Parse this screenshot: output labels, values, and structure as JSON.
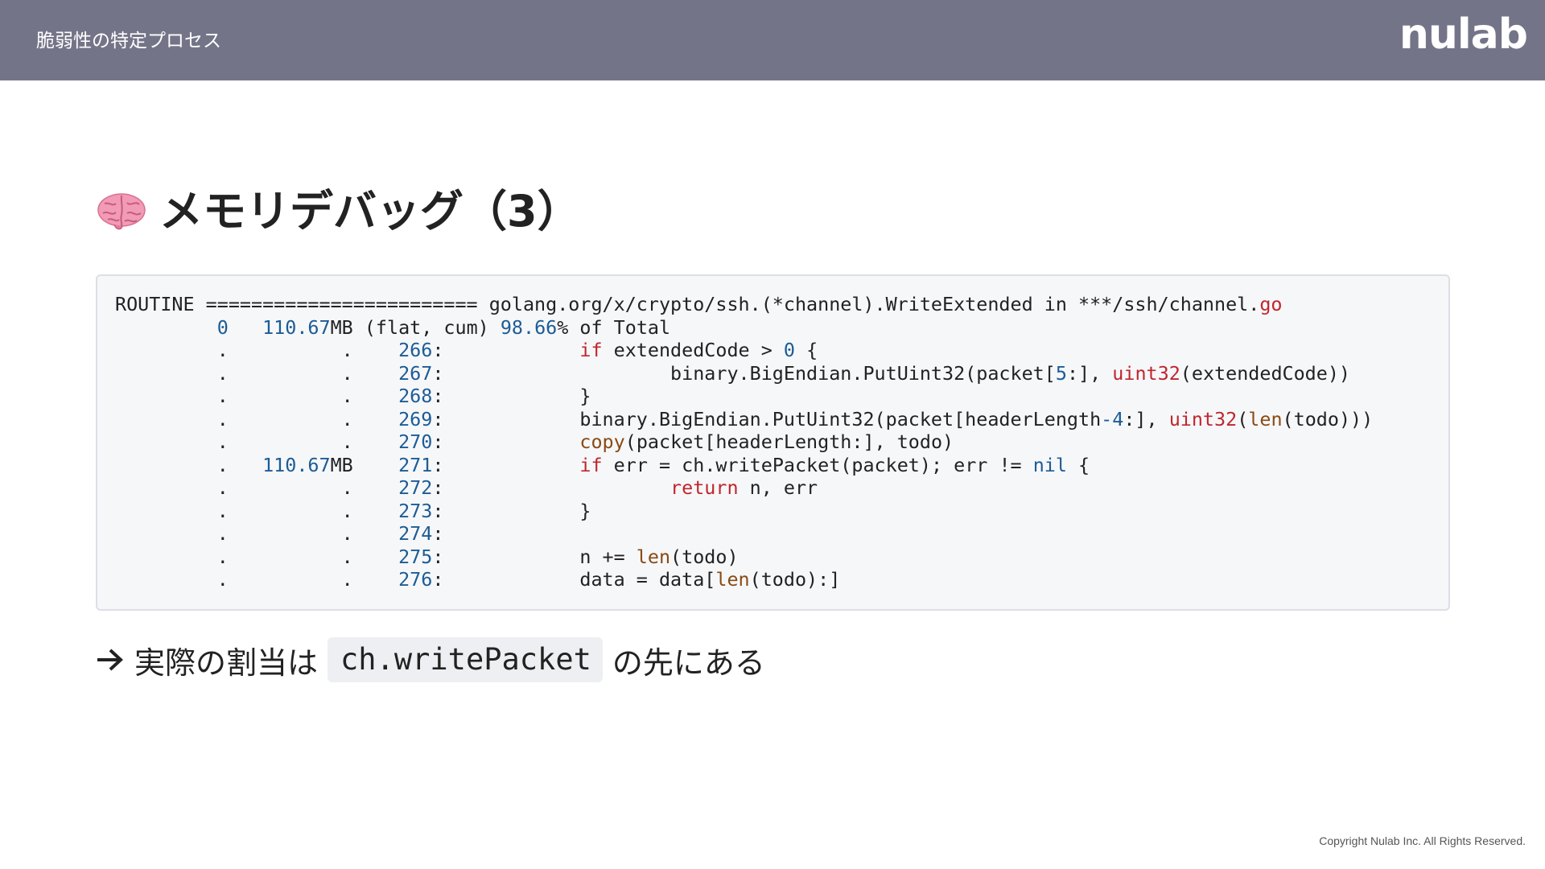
{
  "header": {
    "title": "脆弱性の特定プロセス",
    "logo_text": "nulab"
  },
  "slide": {
    "heading": "メモリデバッグ（3）",
    "heading_icon": "brain-emoji"
  },
  "code": {
    "lines": [
      [
        {
          "t": "ROUTINE ======================== golang.org/x/crypto/ssh.(*channel).WriteExtended in ***/ssh/channel."
        },
        {
          "t": "go",
          "c": "kw"
        }
      ],
      [
        {
          "t": "         "
        },
        {
          "t": "0",
          "c": "num"
        },
        {
          "t": "   "
        },
        {
          "t": "110.67",
          "c": "num"
        },
        {
          "t": "MB (flat, cum) "
        },
        {
          "t": "98.66",
          "c": "num"
        },
        {
          "t": "% of Total"
        }
      ],
      [
        {
          "t": "         .          .    "
        },
        {
          "t": "266",
          "c": "num"
        },
        {
          "t": ":            "
        },
        {
          "t": "if",
          "c": "kw"
        },
        {
          "t": " extendedCode > "
        },
        {
          "t": "0",
          "c": "num"
        },
        {
          "t": " {"
        }
      ],
      [
        {
          "t": "         .          .    "
        },
        {
          "t": "267",
          "c": "num"
        },
        {
          "t": ":                    binary.BigEndian.PutUint32(packet["
        },
        {
          "t": "5",
          "c": "num"
        },
        {
          "t": ":], "
        },
        {
          "t": "uint32",
          "c": "kw"
        },
        {
          "t": "(extendedCode))"
        }
      ],
      [
        {
          "t": "         .          .    "
        },
        {
          "t": "268",
          "c": "num"
        },
        {
          "t": ":            }"
        }
      ],
      [
        {
          "t": "         .          .    "
        },
        {
          "t": "269",
          "c": "num"
        },
        {
          "t": ":            binary.BigEndian.PutUint32(packet[headerLength"
        },
        {
          "t": "-4",
          "c": "num"
        },
        {
          "t": ":], "
        },
        {
          "t": "uint32",
          "c": "kw"
        },
        {
          "t": "("
        },
        {
          "t": "len",
          "c": "fn"
        },
        {
          "t": "(todo)))"
        }
      ],
      [
        {
          "t": "         .          .    "
        },
        {
          "t": "270",
          "c": "num"
        },
        {
          "t": ":            "
        },
        {
          "t": "copy",
          "c": "fn"
        },
        {
          "t": "(packet[headerLength:], todo)"
        }
      ],
      [
        {
          "t": "         .   "
        },
        {
          "t": "110.67",
          "c": "num"
        },
        {
          "t": "MB    "
        },
        {
          "t": "271",
          "c": "num"
        },
        {
          "t": ":            "
        },
        {
          "t": "if",
          "c": "kw"
        },
        {
          "t": " err = ch.writePacket(packet); err != "
        },
        {
          "t": "nil",
          "c": "op"
        },
        {
          "t": " {"
        }
      ],
      [
        {
          "t": "         .          .    "
        },
        {
          "t": "272",
          "c": "num"
        },
        {
          "t": ":                    "
        },
        {
          "t": "return",
          "c": "kw"
        },
        {
          "t": " n, err"
        }
      ],
      [
        {
          "t": "         .          .    "
        },
        {
          "t": "273",
          "c": "num"
        },
        {
          "t": ":            }"
        }
      ],
      [
        {
          "t": "         .          .    "
        },
        {
          "t": "274",
          "c": "num"
        },
        {
          "t": ":"
        }
      ],
      [
        {
          "t": "         .          .    "
        },
        {
          "t": "275",
          "c": "num"
        },
        {
          "t": ":            n += "
        },
        {
          "t": "len",
          "c": "fn"
        },
        {
          "t": "(todo)"
        }
      ],
      [
        {
          "t": "         .          .    "
        },
        {
          "t": "276",
          "c": "num"
        },
        {
          "t": ":            data = data["
        },
        {
          "t": "len",
          "c": "fn"
        },
        {
          "t": "(todo):]"
        }
      ]
    ],
    "colors": {
      "num": "#1c5c96",
      "kw": "#c0262d",
      "fn": "#8a4a13",
      "op": "#1c5c96"
    }
  },
  "conclusion": {
    "arrow_icon": "right-arrow-icon",
    "prefix": "実際の割当は",
    "code": "ch.writePacket",
    "suffix": "の先にある"
  },
  "footer": {
    "copyright": "Copyright  Nulab Inc. All Rights Reserved."
  },
  "colors": {
    "header_bg": "#747489",
    "code_bg": "#f6f7f9"
  }
}
